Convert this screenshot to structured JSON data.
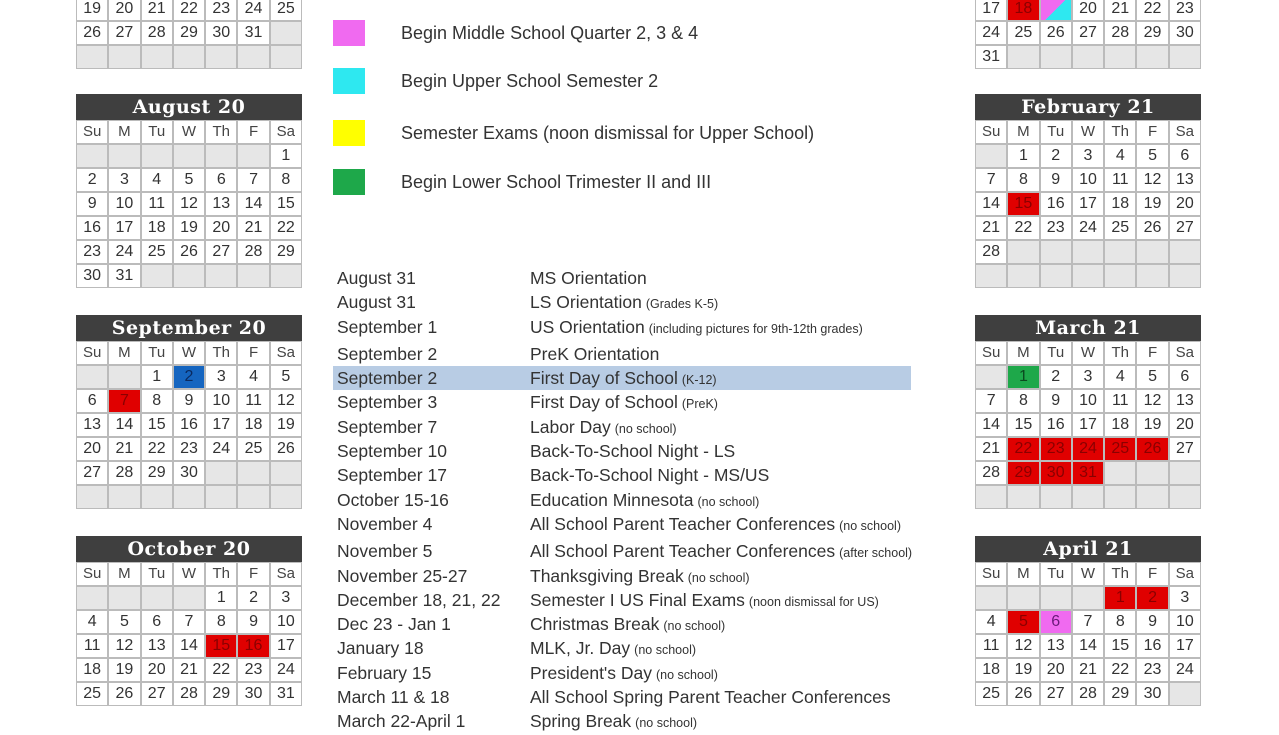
{
  "day_headers": [
    "Su",
    "M",
    "Tu",
    "W",
    "Th",
    "F",
    "Sa"
  ],
  "colors": {
    "no_school_red": "#e00000",
    "first_day_blue": "#1565c0",
    "ms_quarter_pink": "#f06af0",
    "us_semester_cyan": "#2ee8f0",
    "semester_exams_yellow": "#ffff00",
    "ls_trimester_green": "#1ea84a",
    "header_dark": "#3f3f3f",
    "highlight_row": "#b8cce4"
  },
  "calendars": {
    "july_partial": {
      "title": "",
      "rows": [
        [
          "19",
          "20",
          "21",
          "22",
          "23",
          "24",
          "25"
        ],
        [
          "26",
          "27",
          "28",
          "29",
          "30",
          "31",
          ""
        ],
        [
          "",
          "",
          "",
          "",
          "",
          "",
          ""
        ]
      ]
    },
    "august": {
      "title": "August 20",
      "rows": [
        [
          "",
          "",
          "",
          "",
          "",
          "",
          "1"
        ],
        [
          "2",
          "3",
          "4",
          "5",
          "6",
          "7",
          "8"
        ],
        [
          "9",
          "10",
          "11",
          "12",
          "13",
          "14",
          "15"
        ],
        [
          "16",
          "17",
          "18",
          "19",
          "20",
          "21",
          "22"
        ],
        [
          "23",
          "24",
          "25",
          "26",
          "27",
          "28",
          "29"
        ],
        [
          "30",
          "31",
          "",
          "",
          "",
          "",
          ""
        ]
      ]
    },
    "september": {
      "title": "September 20",
      "rows": [
        [
          "",
          "",
          "1",
          "2",
          "3",
          "4",
          "5"
        ],
        [
          "6",
          "7",
          "8",
          "9",
          "10",
          "11",
          "12"
        ],
        [
          "13",
          "14",
          "15",
          "16",
          "17",
          "18",
          "19"
        ],
        [
          "20",
          "21",
          "22",
          "23",
          "24",
          "25",
          "26"
        ],
        [
          "27",
          "28",
          "29",
          "30",
          "",
          "",
          ""
        ],
        [
          "",
          "",
          "",
          "",
          "",
          "",
          ""
        ]
      ],
      "marks": {
        "2": "blue",
        "7": "red"
      }
    },
    "october": {
      "title": "October 20",
      "rows": [
        [
          "",
          "",
          "",
          "",
          "1",
          "2",
          "3"
        ],
        [
          "4",
          "5",
          "6",
          "7",
          "8",
          "9",
          "10"
        ],
        [
          "11",
          "12",
          "13",
          "14",
          "15",
          "16",
          "17"
        ],
        [
          "18",
          "19",
          "20",
          "21",
          "22",
          "23",
          "24"
        ],
        [
          "25",
          "26",
          "27",
          "28",
          "29",
          "30",
          "31"
        ]
      ],
      "marks": {
        "15": "red",
        "16": "red"
      }
    },
    "january_partial": {
      "title": "",
      "rows": [
        [
          "17",
          "18",
          "19",
          "20",
          "21",
          "22",
          "23"
        ],
        [
          "24",
          "25",
          "26",
          "27",
          "28",
          "29",
          "30"
        ],
        [
          "31",
          "",
          "",
          "",
          "",
          "",
          ""
        ]
      ],
      "marks": {
        "18": "red",
        "19": "split"
      }
    },
    "february": {
      "title": "February 21",
      "rows": [
        [
          "",
          "1",
          "2",
          "3",
          "4",
          "5",
          "6"
        ],
        [
          "7",
          "8",
          "9",
          "10",
          "11",
          "12",
          "13"
        ],
        [
          "14",
          "15",
          "16",
          "17",
          "18",
          "19",
          "20"
        ],
        [
          "21",
          "22",
          "23",
          "24",
          "25",
          "26",
          "27"
        ],
        [
          "28",
          "",
          "",
          "",
          "",
          "",
          ""
        ],
        [
          "",
          "",
          "",
          "",
          "",
          "",
          ""
        ]
      ],
      "marks": {
        "15": "red"
      }
    },
    "march": {
      "title": "March 21",
      "rows": [
        [
          "",
          "1",
          "2",
          "3",
          "4",
          "5",
          "6"
        ],
        [
          "7",
          "8",
          "9",
          "10",
          "11",
          "12",
          "13"
        ],
        [
          "14",
          "15",
          "16",
          "17",
          "18",
          "19",
          "20"
        ],
        [
          "21",
          "22",
          "23",
          "24",
          "25",
          "26",
          "27"
        ],
        [
          "28",
          "29",
          "30",
          "31",
          "",
          "",
          ""
        ],
        [
          "",
          "",
          "",
          "",
          "",
          "",
          ""
        ]
      ],
      "marks": {
        "1": "green",
        "22": "red",
        "23": "red",
        "24": "red",
        "25": "red",
        "26": "red",
        "29": "red",
        "30": "red",
        "31": "red"
      }
    },
    "april": {
      "title": "April 21",
      "rows": [
        [
          "",
          "",
          "",
          "",
          "1",
          "2",
          "3"
        ],
        [
          "4",
          "5",
          "6",
          "7",
          "8",
          "9",
          "10"
        ],
        [
          "11",
          "12",
          "13",
          "14",
          "15",
          "16",
          "17"
        ],
        [
          "18",
          "19",
          "20",
          "21",
          "22",
          "23",
          "24"
        ],
        [
          "25",
          "26",
          "27",
          "28",
          "29",
          "30",
          ""
        ]
      ],
      "marks": {
        "1": "red",
        "2": "red",
        "5": "red",
        "6": "pink"
      }
    }
  },
  "legend": [
    {
      "color": "pink",
      "label": "Begin Middle School Quarter 2, 3 & 4"
    },
    {
      "color": "cyan",
      "label": "Begin Upper School Semester 2"
    },
    {
      "color": "yellow",
      "label": "Semester Exams (noon dismissal for Upper School)"
    },
    {
      "color": "green",
      "label": "Begin Lower School Trimester II and III"
    }
  ],
  "events": [
    {
      "date": "August 31",
      "name": "MS Orientation",
      "note": ""
    },
    {
      "date": "August 31",
      "name": "LS Orientation",
      "note": "(Grades K-5)"
    },
    {
      "date": "September 1",
      "name": "US Orientation",
      "note": "(including pictures for 9th-12th grades)"
    },
    {
      "date": "September 2",
      "name": "PreK Orientation",
      "note": ""
    },
    {
      "date": "September 2",
      "name": "First Day of School",
      "note": "(K-12)",
      "highlight": true
    },
    {
      "date": "September 3",
      "name": "First Day of School",
      "note": "(PreK)"
    },
    {
      "date": "September 7",
      "name": "Labor Day",
      "note": "(no school)"
    },
    {
      "date": "September  10",
      "name": "Back-To-School Night - LS",
      "note": ""
    },
    {
      "date": "September  17",
      "name": "Back-To-School Night - MS/US",
      "note": ""
    },
    {
      "date": "October 15-16",
      "name": "Education Minnesota",
      "note": "(no school)"
    },
    {
      "date": "November 4",
      "name": "All School Parent Teacher Conferences",
      "note": "(no school)"
    },
    {
      "date": "November 5",
      "name": "All School Parent Teacher Conferences",
      "note": "(after school)"
    },
    {
      "date": "November 25-27",
      "name": "Thanksgiving Break",
      "note": "(no school)"
    },
    {
      "date": "December 18, 21, 22",
      "name": "Semester I US Final Exams",
      "note": "(noon dismissal for US)"
    },
    {
      "date": "Dec 23 - Jan 1",
      "name": "Christmas Break",
      "note": "(no school)"
    },
    {
      "date": "January 18",
      "name": "MLK, Jr. Day",
      "note": "(no school)"
    },
    {
      "date": "February 15",
      "name": "President's Day",
      "note": "(no school)"
    },
    {
      "date": "March 11 & 18",
      "name": "All School Spring Parent Teacher Conferences",
      "note": ""
    },
    {
      "date": "March 22-April 1",
      "name": "Spring Break",
      "note": "(no school)"
    }
  ]
}
